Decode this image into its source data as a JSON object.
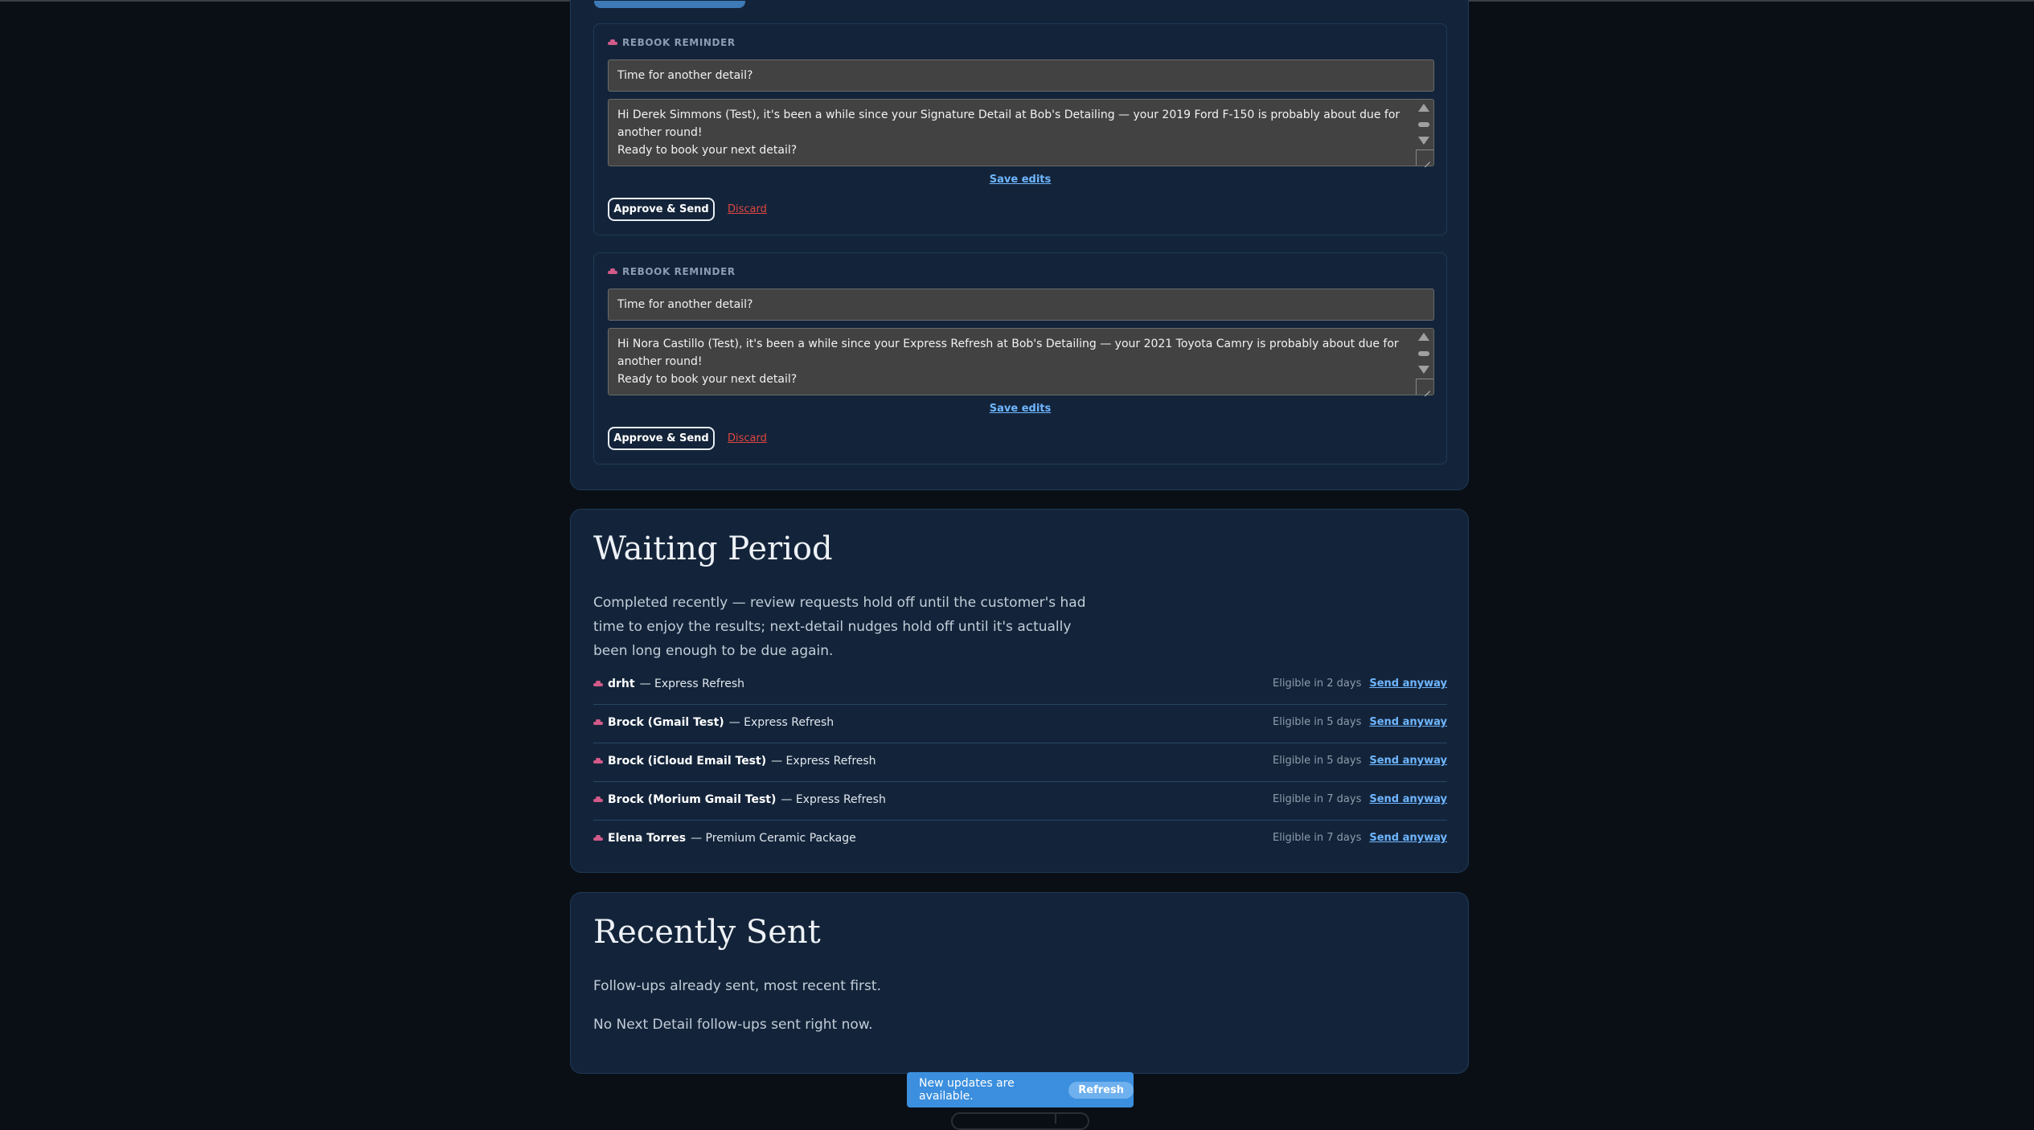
{
  "queue": {
    "cards": [
      {
        "tag": "REBOOK REMINDER",
        "subject": "Time for another detail?",
        "body_line1": "Hi Derek Simmons (Test), it's been a while since your Signature Detail at Bob's Detailing — your 2019 Ford F-150 is probably about due for another round!",
        "body_line2": "Ready to book your next detail?",
        "save_label": "Save edits",
        "approve_label": "Approve & Send",
        "discard_label": "Discard"
      },
      {
        "tag": "REBOOK REMINDER",
        "subject": "Time for another detail?",
        "body_line1": "Hi Nora Castillo (Test), it's been a while since your Express Refresh at Bob's Detailing — your 2021 Toyota Camry is probably about due for another round!",
        "body_line2": "Ready to book your next detail?",
        "save_label": "Save edits",
        "approve_label": "Approve & Send",
        "discard_label": "Discard"
      }
    ]
  },
  "waiting": {
    "title": "Waiting Period",
    "description": "Completed recently — review requests hold off until the customer's had time to enjoy the results; next-detail nudges hold off until it's actually been long enough to be due again.",
    "send_anyway_label": "Send anyway",
    "rows": [
      {
        "name": "drht",
        "service": "— Express Refresh",
        "eligible": "Eligible in 2 days"
      },
      {
        "name": "Brock (Gmail Test)",
        "service": "— Express Refresh",
        "eligible": "Eligible in 5 days"
      },
      {
        "name": "Brock (iCloud Email Test)",
        "service": "— Express Refresh",
        "eligible": "Eligible in 5 days"
      },
      {
        "name": "Brock (Morium Gmail Test)",
        "service": "— Express Refresh",
        "eligible": "Eligible in 7 days"
      },
      {
        "name": "Elena Torres",
        "service": "— Premium Ceramic Package",
        "eligible": "Eligible in 7 days"
      }
    ]
  },
  "sent": {
    "title": "Recently Sent",
    "description": "Follow-ups already sent, most recent first.",
    "empty": "No Next Detail follow-ups sent right now."
  },
  "toast": {
    "message": "New updates are available.",
    "button": "Refresh"
  },
  "icons": {
    "card_tag_icon": "car-icon",
    "row_icon": "car-icon"
  },
  "colors": {
    "background": "#0a0f16",
    "panel": "#13243a",
    "link": "#6fb6ff",
    "danger": "#e0453f",
    "accent_pink": "#d15a89",
    "toast": "#3b8fde"
  }
}
